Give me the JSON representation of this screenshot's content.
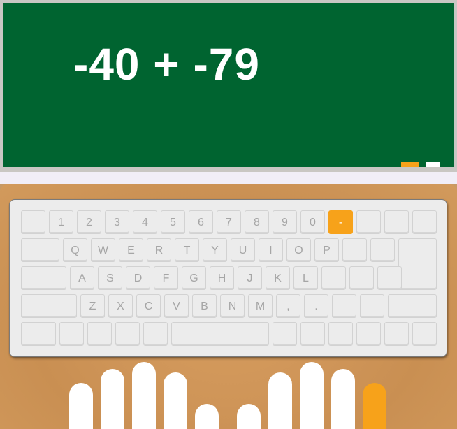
{
  "board": {
    "problem": "-40 + -79"
  },
  "colors": {
    "board_green": "#006430",
    "accent_orange": "#f7a21a",
    "key_gray": "#ececec",
    "key_text": "#a6a6a6"
  },
  "keyboard": {
    "row1": [
      "",
      "1",
      "2",
      "3",
      "4",
      "5",
      "6",
      "7",
      "8",
      "9",
      "0",
      "-",
      "",
      "",
      ""
    ],
    "row2": [
      "",
      "Q",
      "W",
      "E",
      "R",
      "T",
      "Y",
      "U",
      "I",
      "O",
      "P",
      "",
      "",
      ""
    ],
    "row3": [
      "",
      "A",
      "S",
      "D",
      "F",
      "G",
      "H",
      "J",
      "K",
      "L",
      "",
      "",
      ""
    ],
    "row4": [
      "",
      "Z",
      "X",
      "C",
      "V",
      "B",
      "N",
      "M",
      ",",
      ".",
      "",
      "",
      ""
    ],
    "row5": [
      "",
      "",
      "",
      "",
      "",
      "",
      "",
      "",
      "",
      "",
      "",
      ""
    ],
    "highlighted_key": "-"
  },
  "hands": {
    "highlighted_finger": "right-pinky"
  }
}
